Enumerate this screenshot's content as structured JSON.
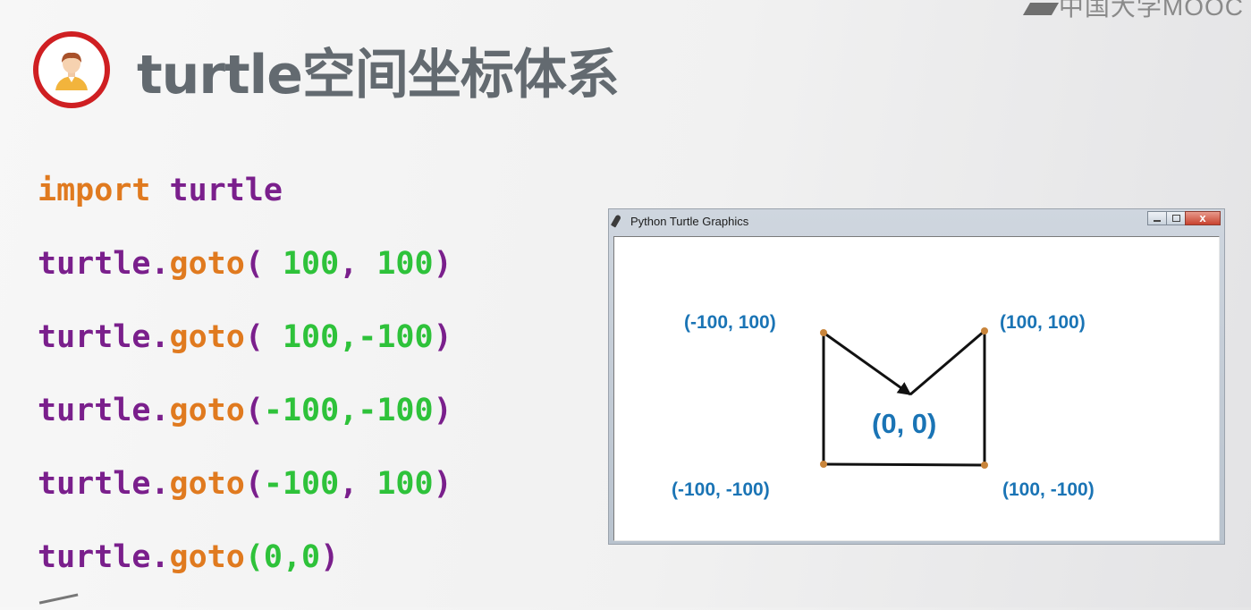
{
  "watermark": "中国大学MOOC",
  "title": "turtle空间坐标体系",
  "code": {
    "line1": {
      "kw": "import",
      "mod": "turtle"
    },
    "obj": "turtle",
    "dot": ".",
    "fn": "goto",
    "open": "(",
    "close": ")",
    "lines": [
      {
        "args": [
          " 100",
          ", ",
          "100"
        ]
      },
      {
        "args": [
          " 100",
          ",",
          "-100"
        ]
      },
      {
        "args": [
          "-100",
          ",",
          "-100"
        ]
      },
      {
        "args": [
          "-100",
          ", ",
          "100"
        ]
      },
      {
        "args": [
          "0",
          ",",
          "0"
        ]
      }
    ]
  },
  "window": {
    "title": "Python Turtle Graphics",
    "buttons": [
      "minimize",
      "maximize",
      "close"
    ]
  },
  "coords": {
    "top_left": "(-100, 100)",
    "top_right": "(100, 100)",
    "bottom_left": "(-100, -100)",
    "bottom_right": "(100, -100)",
    "origin": "(0, 0)"
  },
  "colors": {
    "title": "#636a70",
    "keyword": "#e07a1f",
    "module": "#7a1f8c",
    "number": "#2ec23a",
    "coord_label": "#1a74b5",
    "avatar_ring": "#cf1f22",
    "vertex_dot": "#c8843a"
  },
  "icons": {
    "avatar": "user-avatar-icon",
    "window": "feather-icon"
  }
}
